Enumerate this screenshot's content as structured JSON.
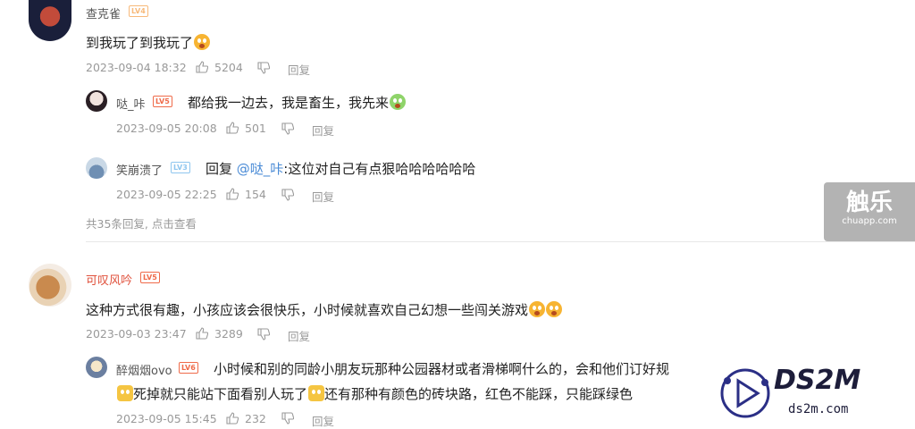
{
  "comments": [
    {
      "user": "查克雀",
      "level": "LV4",
      "text": "到我玩了到我玩了",
      "date": "2023-09-04 18:32",
      "likes": "5204",
      "reply_label": "回复"
    },
    {
      "user": "哒_咔",
      "level": "LV5",
      "text": "都给我一边去，我是畜生，我先来",
      "date": "2023-09-05 20:08",
      "likes": "501",
      "reply_label": "回复"
    },
    {
      "user": "笑崩溃了",
      "level": "LV3",
      "reply_prefix": "回复 ",
      "mention": "@哒_咔",
      "text": ":这位对自己有点狠哈哈哈哈哈哈",
      "date": "2023-09-05 22:25",
      "likes": "154",
      "reply_label": "回复"
    },
    {
      "user": "可叹风吟",
      "level": "LV5",
      "text": "这种方式很有趣，小孩应该会很快乐，小时候就喜欢自己幻想一些闯关游戏",
      "date": "2023-09-03 23:47",
      "likes": "3289",
      "reply_label": "回复"
    },
    {
      "user": "醉烟烟ovo",
      "level": "LV6",
      "text_line1": "小时候和别的同龄小朋友玩那种公园器材或者滑梯啊什么的，会和他们订好规",
      "text_line2a": "死掉就只能站下面看别人玩了",
      "text_line2b": "还有那种有颜色的砖块路，红色不能踩，只能踩绿色",
      "date": "2023-09-05 15:45",
      "likes": "232",
      "reply_label": "回复"
    }
  ],
  "more_replies": "共35条回复, 点击查看",
  "badge": {
    "title": "触乐",
    "domain": "chuapp.com"
  },
  "watermark": {
    "brand": "DS2M",
    "domain": "ds2m.com"
  },
  "colors": {
    "vip_name": "#e0513c",
    "meta": "#999999",
    "mention": "#4a8bd6"
  }
}
